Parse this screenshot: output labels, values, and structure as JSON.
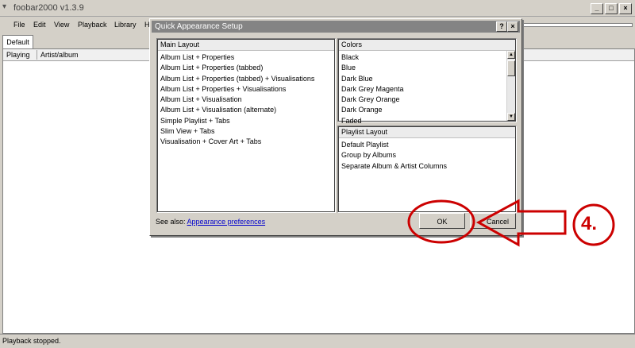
{
  "window": {
    "title": "foobar2000 v1.3.9"
  },
  "menu": {
    "items": [
      "File",
      "Edit",
      "View",
      "Playback",
      "Library",
      "H"
    ]
  },
  "tabs": [
    "Default"
  ],
  "list": {
    "columns": [
      "Playing",
      "Artist/album"
    ]
  },
  "status": {
    "text": "Playback stopped."
  },
  "dialog": {
    "title": "Quick Appearance Setup",
    "help_glyph": "?",
    "close_glyph": "×",
    "main_layout": {
      "header": "Main Layout",
      "items": [
        "Album List + Properties",
        "Album List + Properties (tabbed)",
        "Album List + Properties (tabbed) + Visualisations",
        "Album List + Properties + Visualisations",
        "Album List + Visualisation",
        "Album List + Visualisation (alternate)",
        "Simple Playlist + Tabs",
        "Slim View + Tabs",
        "Visualisation + Cover Art + Tabs"
      ]
    },
    "colors": {
      "header": "Colors",
      "items": [
        "Black",
        "Blue",
        "Dark Blue",
        "Dark Grey Magenta",
        "Dark Grey Orange",
        "Dark Orange",
        "Faded"
      ]
    },
    "playlist_layout": {
      "header": "Playlist Layout",
      "items": [
        "Default Playlist",
        "Group by Albums",
        "Separate Album & Artist Columns"
      ]
    },
    "see_also_label": "See also:",
    "see_also_link": "Appearance preferences",
    "ok_label": "OK",
    "cancel_label": "Cancel"
  },
  "annotation": {
    "step": "4.",
    "color": "#cc0000"
  }
}
